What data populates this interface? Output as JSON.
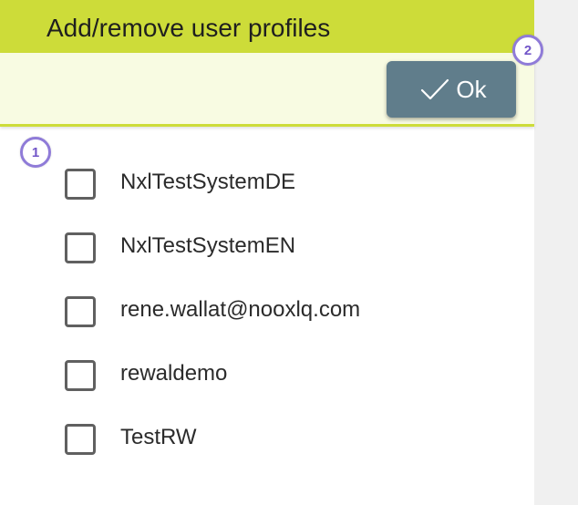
{
  "dialog": {
    "title": "Add/remove user profiles",
    "ok_label": "Ok",
    "ok_icon": "check-icon"
  },
  "badges": {
    "profiles": "1",
    "ok": "2"
  },
  "profiles": [
    {
      "label": "NxlTestSystemDE",
      "checked": false
    },
    {
      "label": "NxlTestSystemEN",
      "checked": false
    },
    {
      "label": "rene.wallat@nooxlq.com",
      "checked": false
    },
    {
      "label": "rewaldemo",
      "checked": false
    },
    {
      "label": "TestRW",
      "checked": false
    }
  ],
  "colors": {
    "header": "#cddc39",
    "toolbar": "#f8fbe2",
    "ok_button": "#607d8b",
    "badge_border": "#8f7bd8",
    "checkbox_border": "#606060",
    "right_gutter": "#f0f0f0"
  }
}
